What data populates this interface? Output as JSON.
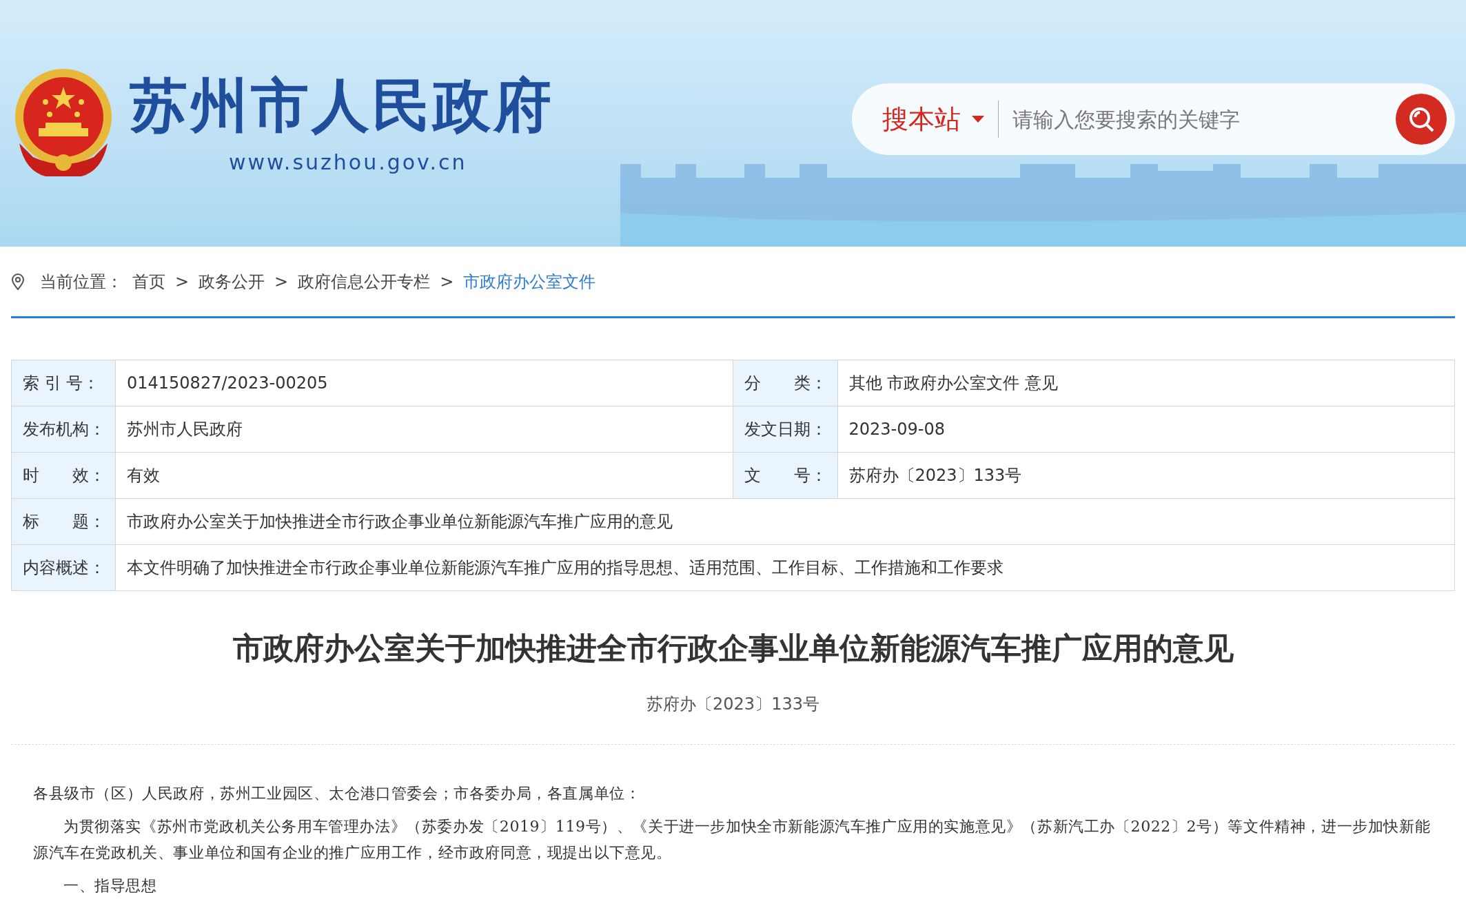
{
  "header": {
    "site_name": "苏州市人民政府",
    "site_url": "www.suzhou.gov.cn",
    "search": {
      "scope": "搜本站",
      "placeholder": "请输入您要搜索的关键字"
    }
  },
  "breadcrumb": {
    "label": "当前位置：",
    "items": [
      {
        "text": "首页",
        "selected": false
      },
      {
        "separator": ">",
        "text": "政务公开",
        "selected": false
      },
      {
        "separator": ">",
        "text": "政府信息公开专栏",
        "selected": false
      },
      {
        "separator": ">",
        "text": "市政府办公室文件",
        "selected": true
      }
    ]
  },
  "info_table": {
    "rows": [
      [
        {
          "label": "索 引 号：",
          "value": "014150827/2023-00205"
        },
        {
          "label": "分　　类：",
          "value": "其他 市政府办公室文件 意见"
        }
      ],
      [
        {
          "label": "发布机构：",
          "value": "苏州市人民政府"
        },
        {
          "label": "发文日期：",
          "value": "2023-09-08"
        }
      ],
      [
        {
          "label": "时　　效：",
          "value": "有效"
        },
        {
          "label": "文　　号：",
          "value": "苏府办〔2023〕133号"
        }
      ],
      [
        {
          "label": "标　　题：",
          "value": "市政府办公室关于加快推进全市行政企事业单位新能源汽车推广应用的意见"
        }
      ],
      [
        {
          "label": "内容概述：",
          "value": "本文件明确了加快推进全市行政企事业单位新能源汽车推广应用的指导思想、适用范围、工作目标、工作措施和工作要求"
        }
      ]
    ]
  },
  "article": {
    "title": "市政府办公室关于加快推进全市行政企事业单位新能源汽车推广应用的意见",
    "doc_number": "苏府办〔2023〕133号",
    "paragraphs": [
      {
        "kind": "salutation",
        "text": "各县级市（区）人民政府，苏州工业园区、太仓港口管委会；市各委办局，各直属单位："
      },
      {
        "kind": "body",
        "text": "为贯彻落实《苏州市党政机关公务用车管理办法》（苏委办发〔2019〕119号）、《关于进一步加快全市新能源汽车推广应用的实施意见》（苏新汽工办〔2022〕2号）等文件精神，进一步加快新能源汽车在党政机关、事业单位和国有企业的推广应用工作，经市政府同意，现提出以下意见。"
      },
      {
        "kind": "body",
        "text": "一、指导思想"
      }
    ]
  }
}
